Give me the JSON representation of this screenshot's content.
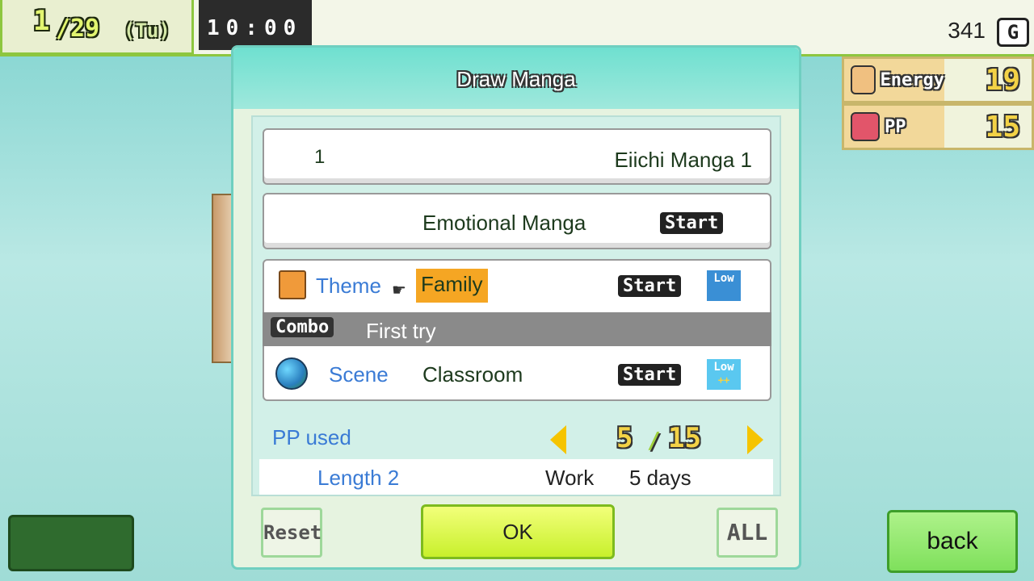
{
  "top": {
    "date_month": "1",
    "date_day": "/29",
    "date_weekday": "(Tu)",
    "time": "10:00",
    "gold_amount": "341",
    "gold_icon_letter": "G"
  },
  "stats": {
    "energy_label": "Energy",
    "energy_value": "19",
    "pp_label": "PP",
    "pp_value": "15"
  },
  "dialog": {
    "title": "Draw Manga",
    "series_number": "1",
    "series_name": "Eiichi Manga 1",
    "genre": "Emotional Manga",
    "genre_start": "Start",
    "theme_label": "Theme",
    "theme_value": "Family",
    "theme_start": "Start",
    "theme_level": "Low",
    "combo_label": "Combo",
    "combo_text": "First try",
    "scene_label": "Scene",
    "scene_value": "Classroom",
    "scene_start": "Start",
    "scene_level": "Low",
    "scene_level_extra": "++",
    "pp_used_label": "PP used",
    "pp_used_current": "5",
    "pp_used_sep": "/",
    "pp_used_max": "15",
    "length_label": "Length 2",
    "work_label": "Work",
    "work_value": "5 days"
  },
  "buttons": {
    "reset": "Reset",
    "ok": "OK",
    "all": "ALL",
    "back": "back"
  },
  "colors": {
    "accent_green": "#8dc63f",
    "theme_highlight": "#f5a623",
    "label_blue": "#3a7bd5",
    "combo_bar": "#8a8a8a"
  }
}
